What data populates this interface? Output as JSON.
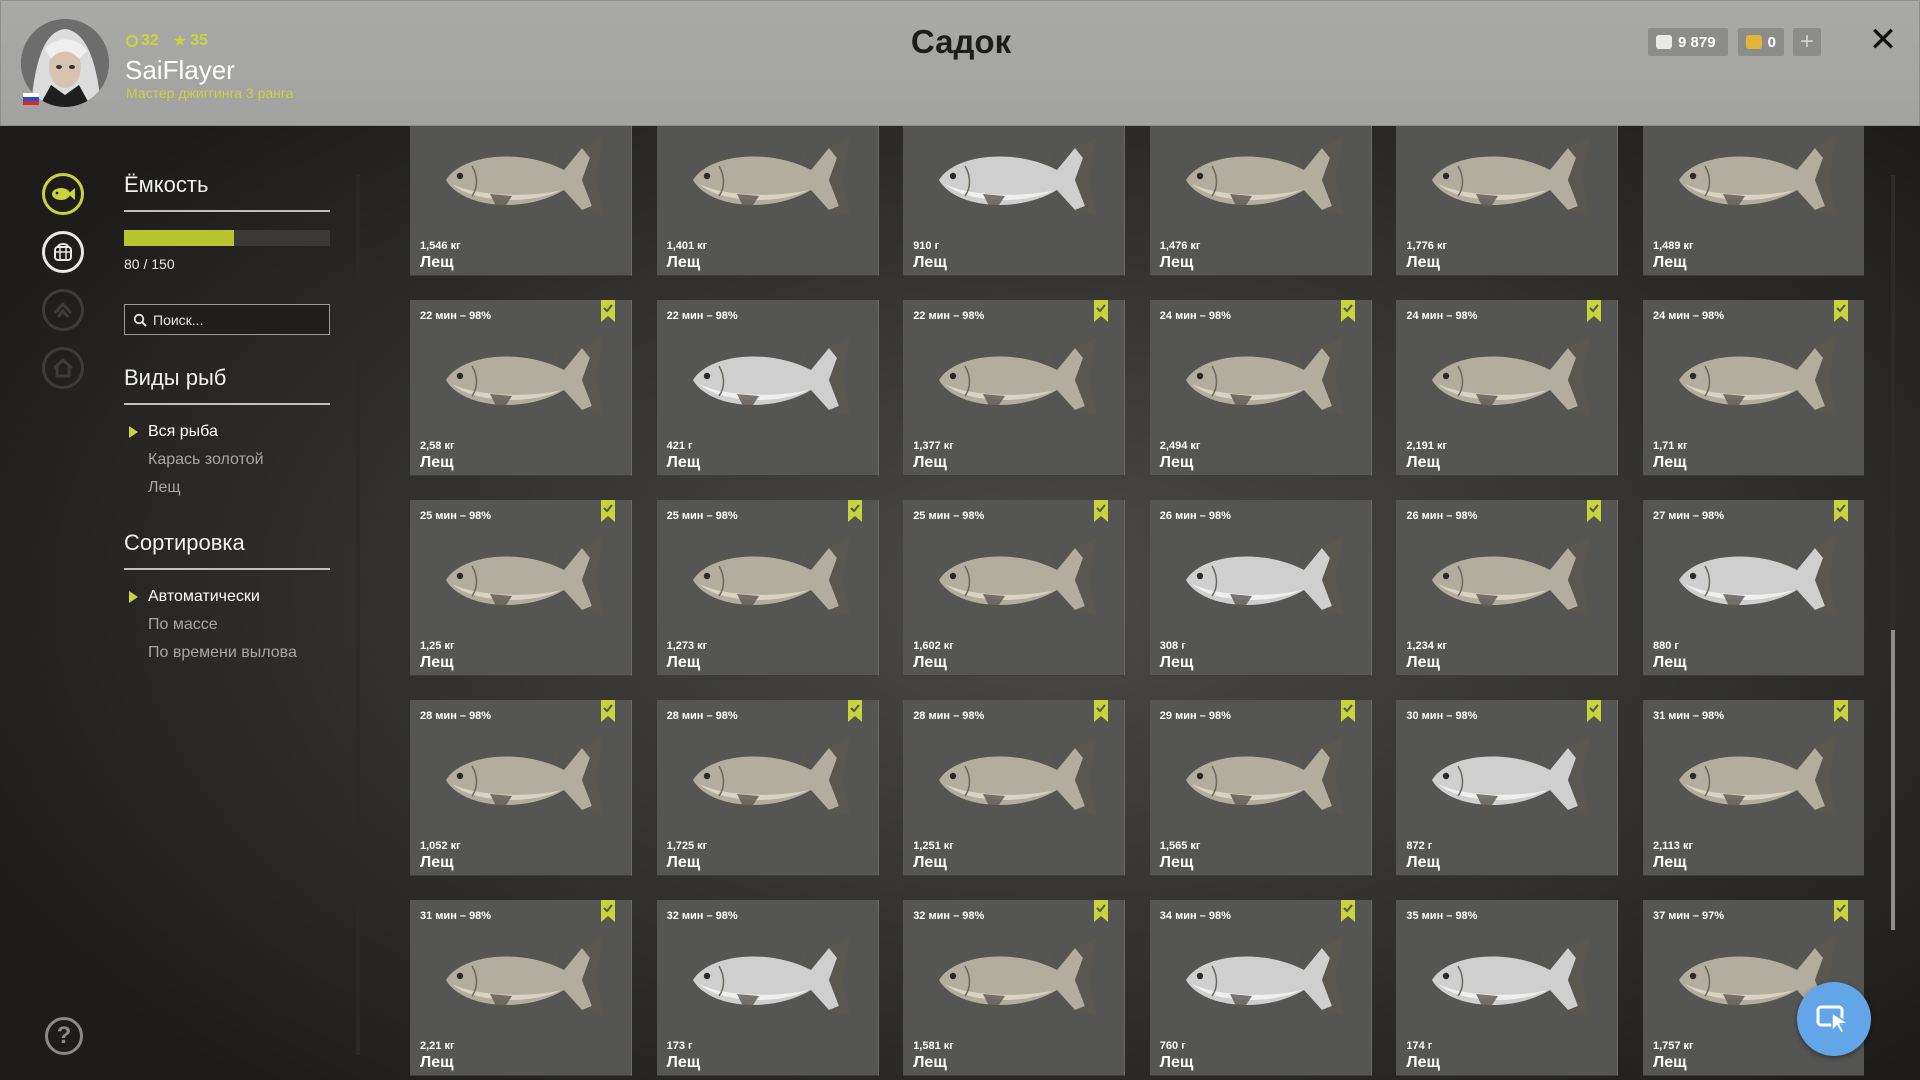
{
  "header": {
    "title": "Садок",
    "player": {
      "level": "32",
      "stars": "35",
      "name": "SaiFlayer",
      "rank": "Мастер джиггинга 3 ранга"
    },
    "currency": {
      "silver": "9 879",
      "gold": "0"
    },
    "icons": [
      "avatar",
      "russia-flag-icon",
      "silver-coin-icon",
      "gold-coin-icon",
      "plus-icon",
      "close-icon"
    ]
  },
  "sidebar": {
    "capacity": {
      "title": "Ёмкость",
      "used": 80,
      "total": 150,
      "label": "80 / 150",
      "fill_fraction": 0.533
    },
    "search": {
      "placeholder": "Поиск..."
    },
    "types": {
      "title": "Виды рыб",
      "items": [
        {
          "label": "Вся рыба",
          "active": true
        },
        {
          "label": "Карась золотой",
          "active": false
        },
        {
          "label": "Лещ",
          "active": false
        }
      ]
    },
    "sort": {
      "title": "Сортировка",
      "items": [
        {
          "label": "Автоматически",
          "active": true
        },
        {
          "label": "По массе",
          "active": false
        },
        {
          "label": "По времени вылова",
          "active": false
        }
      ]
    },
    "rail_icons": [
      "fish-tab-icon",
      "keepnet-tab-icon",
      "upgrade-tab-icon",
      "home-tab-icon",
      "help-icon"
    ]
  },
  "colors": {
    "accent": "#c7d43b",
    "card": "#555553",
    "fab": "#63a6e8"
  },
  "fish_rows": [
    [
      {
        "time": "",
        "weight": "1,546 кг",
        "name": "Лещ",
        "marked": false,
        "silver": false
      },
      {
        "time": "",
        "weight": "1,401 кг",
        "name": "Лещ",
        "marked": false,
        "silver": false
      },
      {
        "time": "",
        "weight": "910 г",
        "name": "Лещ",
        "marked": false,
        "silver": true
      },
      {
        "time": "",
        "weight": "1,476 кг",
        "name": "Лещ",
        "marked": false,
        "silver": false
      },
      {
        "time": "",
        "weight": "1,776 кг",
        "name": "Лещ",
        "marked": false,
        "silver": false
      },
      {
        "time": "",
        "weight": "1,489 кг",
        "name": "Лещ",
        "marked": false,
        "silver": false
      }
    ],
    [
      {
        "time": "22 мин – 98%",
        "weight": "2,58 кг",
        "name": "Лещ",
        "marked": true,
        "silver": false
      },
      {
        "time": "22 мин – 98%",
        "weight": "421 г",
        "name": "Лещ",
        "marked": false,
        "silver": true
      },
      {
        "time": "22 мин – 98%",
        "weight": "1,377 кг",
        "name": "Лещ",
        "marked": true,
        "silver": false
      },
      {
        "time": "24 мин – 98%",
        "weight": "2,494 кг",
        "name": "Лещ",
        "marked": true,
        "silver": false
      },
      {
        "time": "24 мин – 98%",
        "weight": "2,191 кг",
        "name": "Лещ",
        "marked": true,
        "silver": false
      },
      {
        "time": "24 мин – 98%",
        "weight": "1,71 кг",
        "name": "Лещ",
        "marked": true,
        "silver": false
      }
    ],
    [
      {
        "time": "25 мин – 98%",
        "weight": "1,25 кг",
        "name": "Лещ",
        "marked": true,
        "silver": false
      },
      {
        "time": "25 мин – 98%",
        "weight": "1,273 кг",
        "name": "Лещ",
        "marked": true,
        "silver": false
      },
      {
        "time": "25 мин – 98%",
        "weight": "1,602 кг",
        "name": "Лещ",
        "marked": true,
        "silver": false
      },
      {
        "time": "26 мин – 98%",
        "weight": "308 г",
        "name": "Лещ",
        "marked": false,
        "silver": true
      },
      {
        "time": "26 мин – 98%",
        "weight": "1,234 кг",
        "name": "Лещ",
        "marked": true,
        "silver": false
      },
      {
        "time": "27 мин – 98%",
        "weight": "880 г",
        "name": "Лещ",
        "marked": true,
        "silver": true
      }
    ],
    [
      {
        "time": "28 мин – 98%",
        "weight": "1,052 кг",
        "name": "Лещ",
        "marked": true,
        "silver": false
      },
      {
        "time": "28 мин – 98%",
        "weight": "1,725 кг",
        "name": "Лещ",
        "marked": true,
        "silver": false
      },
      {
        "time": "28 мин – 98%",
        "weight": "1,251 кг",
        "name": "Лещ",
        "marked": true,
        "silver": false
      },
      {
        "time": "29 мин – 98%",
        "weight": "1,565 кг",
        "name": "Лещ",
        "marked": true,
        "silver": false
      },
      {
        "time": "30 мин – 98%",
        "weight": "872 г",
        "name": "Лещ",
        "marked": true,
        "silver": true
      },
      {
        "time": "31 мин – 98%",
        "weight": "2,113 кг",
        "name": "Лещ",
        "marked": true,
        "silver": false
      }
    ],
    [
      {
        "time": "31 мин – 98%",
        "weight": "2,21 кг",
        "name": "Лещ",
        "marked": true,
        "silver": false
      },
      {
        "time": "32 мин – 98%",
        "weight": "173 г",
        "name": "Лещ",
        "marked": false,
        "silver": true
      },
      {
        "time": "32 мин – 98%",
        "weight": "1,581 кг",
        "name": "Лещ",
        "marked": true,
        "silver": false
      },
      {
        "time": "34 мин – 98%",
        "weight": "760 г",
        "name": "Лещ",
        "marked": true,
        "silver": true
      },
      {
        "time": "35 мин – 98%",
        "weight": "174 г",
        "name": "Лещ",
        "marked": false,
        "silver": true
      },
      {
        "time": "37 мин – 97%",
        "weight": "1,757 кг",
        "name": "Лещ",
        "marked": true,
        "silver": false
      }
    ]
  ]
}
